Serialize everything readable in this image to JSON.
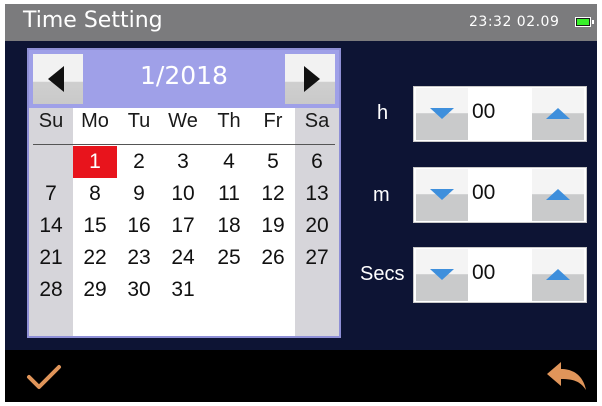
{
  "window": {
    "title": "Time Setting",
    "clock": "23:32  02.09",
    "battery_icon": "battery-icon",
    "battery_color": "#38f02a"
  },
  "calendar": {
    "month_label": "1/2018",
    "prev_icon": "triangle-left-icon",
    "next_icon": "triangle-right-icon",
    "weekdays": [
      "Su",
      "Mo",
      "Tu",
      "We",
      "Th",
      "Fr",
      "Sa"
    ],
    "weeks": [
      [
        "",
        "1",
        "2",
        "3",
        "4",
        "5",
        "6"
      ],
      [
        "7",
        "8",
        "9",
        "10",
        "11",
        "12",
        "13"
      ],
      [
        "14",
        "15",
        "16",
        "17",
        "18",
        "19",
        "20"
      ],
      [
        "21",
        "22",
        "23",
        "24",
        "25",
        "26",
        "27"
      ],
      [
        "28",
        "29",
        "30",
        "31",
        "",
        "",
        ""
      ]
    ],
    "selected_day": "1",
    "selected_color": "#e8141c",
    "header_color": "#9fa0e8"
  },
  "time": {
    "hour": {
      "label": "h",
      "value": "00"
    },
    "minute": {
      "label": "m",
      "value": "00"
    },
    "second": {
      "label": "Secs",
      "value": "00"
    },
    "decrement_icon": "triangle-down-icon",
    "increment_icon": "triangle-up-icon",
    "arrow_color": "#3e8fdc"
  },
  "footer": {
    "confirm_icon": "checkmark-icon",
    "back_icon": "return-arrow-icon",
    "icon_color": "#e0955a"
  }
}
